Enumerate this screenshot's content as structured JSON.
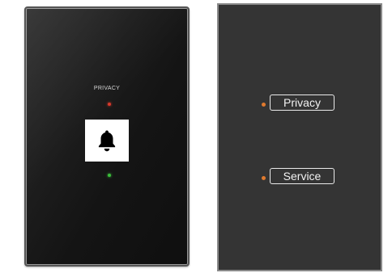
{
  "left_panel": {
    "caption": "PRIVACY",
    "top_led_color": "#d9392b",
    "bottom_led_color": "#3bbf3b",
    "button_icon": "bell-icon"
  },
  "right_panel": {
    "items": [
      {
        "label": "Privacy",
        "dot_color": "#e07a2e"
      },
      {
        "label": "Service",
        "dot_color": "#e07a2e"
      }
    ]
  }
}
